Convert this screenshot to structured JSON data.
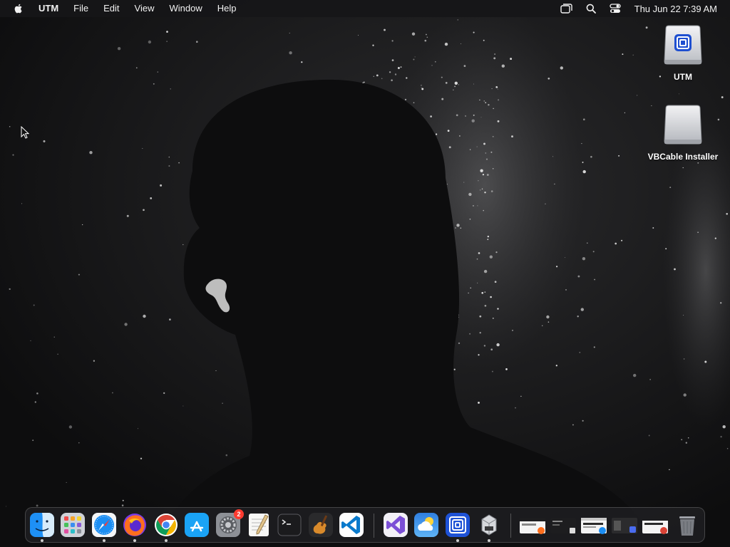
{
  "menubar": {
    "app_name": "UTM",
    "items": [
      "File",
      "Edit",
      "View",
      "Window",
      "Help"
    ],
    "clock": "Thu Jun 22  7:39 AM",
    "status_icons": [
      "window-stack-icon",
      "search-icon",
      "control-center-icon"
    ]
  },
  "desktop": {
    "icons": [
      {
        "label": "UTM",
        "icon": "utm-disk-icon"
      },
      {
        "label": "VBCable Installer",
        "icon": "disk-image-icon"
      }
    ]
  },
  "dock": {
    "apps": [
      {
        "icon": "finder-icon",
        "running": true
      },
      {
        "icon": "launchpad-icon",
        "running": false
      },
      {
        "icon": "safari-icon",
        "running": true
      },
      {
        "icon": "firefox-icon",
        "running": true
      },
      {
        "icon": "chrome-icon",
        "running": true
      },
      {
        "icon": "app-store-icon",
        "running": false
      },
      {
        "icon": "system-settings-icon",
        "running": false,
        "badge": "2"
      },
      {
        "icon": "textedit-icon",
        "running": false
      },
      {
        "icon": "terminal-icon",
        "running": false
      },
      {
        "icon": "garageband-icon",
        "running": false
      },
      {
        "icon": "vscode-icon",
        "running": false
      },
      {
        "icon": "visual-studio-icon",
        "running": false
      },
      {
        "icon": "weather-icon",
        "running": false
      },
      {
        "icon": "utm-icon",
        "running": true
      },
      {
        "icon": "installer-icon",
        "running": true
      }
    ],
    "minimized": [
      "window-thumb-1",
      "window-thumb-2",
      "window-thumb-3",
      "window-thumb-4",
      "window-thumb-5"
    ],
    "trash_icon": "trash-icon"
  },
  "colors": {
    "menubar_bg": "#161618",
    "dock_bg": "#28282c",
    "badge": "#ff3b30",
    "vscode_blue": "#0a7acc",
    "chrome_red": "#db4437"
  }
}
